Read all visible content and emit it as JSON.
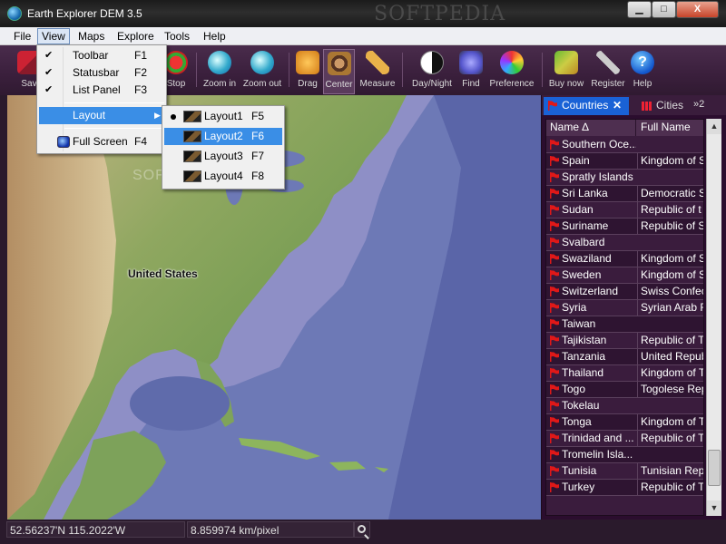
{
  "window": {
    "title": "Earth Explorer DEM 3.5",
    "watermark": "SOFTPEDIA",
    "min_label": "▁",
    "max_label": "□",
    "close_label": "X"
  },
  "menubar": {
    "items": [
      "File",
      "View",
      "Maps",
      "Explore",
      "Tools",
      "Help"
    ]
  },
  "toolbar": {
    "buttons": [
      {
        "label": "Sav",
        "icon": "save-icon"
      },
      {
        "label": "Stop",
        "icon": "stop-icon"
      },
      {
        "label": "Zoom in",
        "icon": "zoom-in-icon"
      },
      {
        "label": "Zoom out",
        "icon": "zoom-out-icon"
      },
      {
        "label": "Drag",
        "icon": "drag-hand-icon"
      },
      {
        "label": "Center",
        "icon": "center-icon"
      },
      {
        "label": "Measure",
        "icon": "ruler-icon"
      },
      {
        "label": "Day/Night",
        "icon": "day-night-icon"
      },
      {
        "label": "Find",
        "icon": "find-icon"
      },
      {
        "label": "Preference",
        "icon": "preference-icon"
      },
      {
        "label": "Buy now",
        "icon": "buy-icon"
      },
      {
        "label": "Register",
        "icon": "key-icon"
      },
      {
        "label": "Help",
        "icon": "help-icon"
      }
    ]
  },
  "view_menu": {
    "items": [
      {
        "label": "Toolbar",
        "key": "F1",
        "checked": true
      },
      {
        "label": "Statusbar",
        "key": "F2",
        "checked": true
      },
      {
        "label": "List Panel",
        "key": "F3",
        "checked": true
      },
      {
        "label": "Layout",
        "key": "",
        "submenu": true
      },
      {
        "label": "Full Screen",
        "key": "F4"
      }
    ]
  },
  "layout_menu": {
    "items": [
      {
        "label": "Layout1",
        "key": "F5",
        "selected": true
      },
      {
        "label": "Layout2",
        "key": "F6",
        "highlighted": true
      },
      {
        "label": "Layout3",
        "key": "F7"
      },
      {
        "label": "Layout4",
        "key": "F8"
      }
    ]
  },
  "map": {
    "label": "United States",
    "watermark": "SOFTPEDIA"
  },
  "panel": {
    "tabs": {
      "countries": "Countries",
      "cities": "Cities",
      "more": "»2"
    },
    "columns": {
      "name": "Name ∆",
      "full": "Full Name"
    },
    "rows": [
      {
        "name": "Southern Oce...",
        "full": ""
      },
      {
        "name": "Spain",
        "full": "Kingdom of S"
      },
      {
        "name": "Spratly Islands",
        "full": ""
      },
      {
        "name": "Sri Lanka",
        "full": "Democratic S"
      },
      {
        "name": "Sudan",
        "full": "Republic of t"
      },
      {
        "name": "Suriname",
        "full": "Republic of S"
      },
      {
        "name": "Svalbard",
        "full": ""
      },
      {
        "name": "Swaziland",
        "full": "Kingdom of S"
      },
      {
        "name": "Sweden",
        "full": "Kingdom of S"
      },
      {
        "name": "Switzerland",
        "full": "Swiss Confec"
      },
      {
        "name": "Syria",
        "full": "Syrian Arab R"
      },
      {
        "name": "Taiwan",
        "full": ""
      },
      {
        "name": "Tajikistan",
        "full": "Republic of T"
      },
      {
        "name": "Tanzania",
        "full": "United Repub"
      },
      {
        "name": "Thailand",
        "full": "Kingdom of T"
      },
      {
        "name": "Togo",
        "full": "Togolese Rep"
      },
      {
        "name": "Tokelau",
        "full": ""
      },
      {
        "name": "Tonga",
        "full": "Kingdom of T"
      },
      {
        "name": "Trinidad and ...",
        "full": "Republic of T"
      },
      {
        "name": "Tromelin Isla...",
        "full": ""
      },
      {
        "name": "Tunisia",
        "full": "Tunisian Rep"
      },
      {
        "name": "Turkey",
        "full": "Republic of T"
      }
    ]
  },
  "statusbar": {
    "coordinates": "52.56237'N  115.2022'W",
    "scale": "8.859974 km/pixel"
  },
  "colors": {
    "flag": "#e01818",
    "ocean": "#6d79b6",
    "panel_bg": "#2b0d2e",
    "accent": "#3a8ee6"
  }
}
